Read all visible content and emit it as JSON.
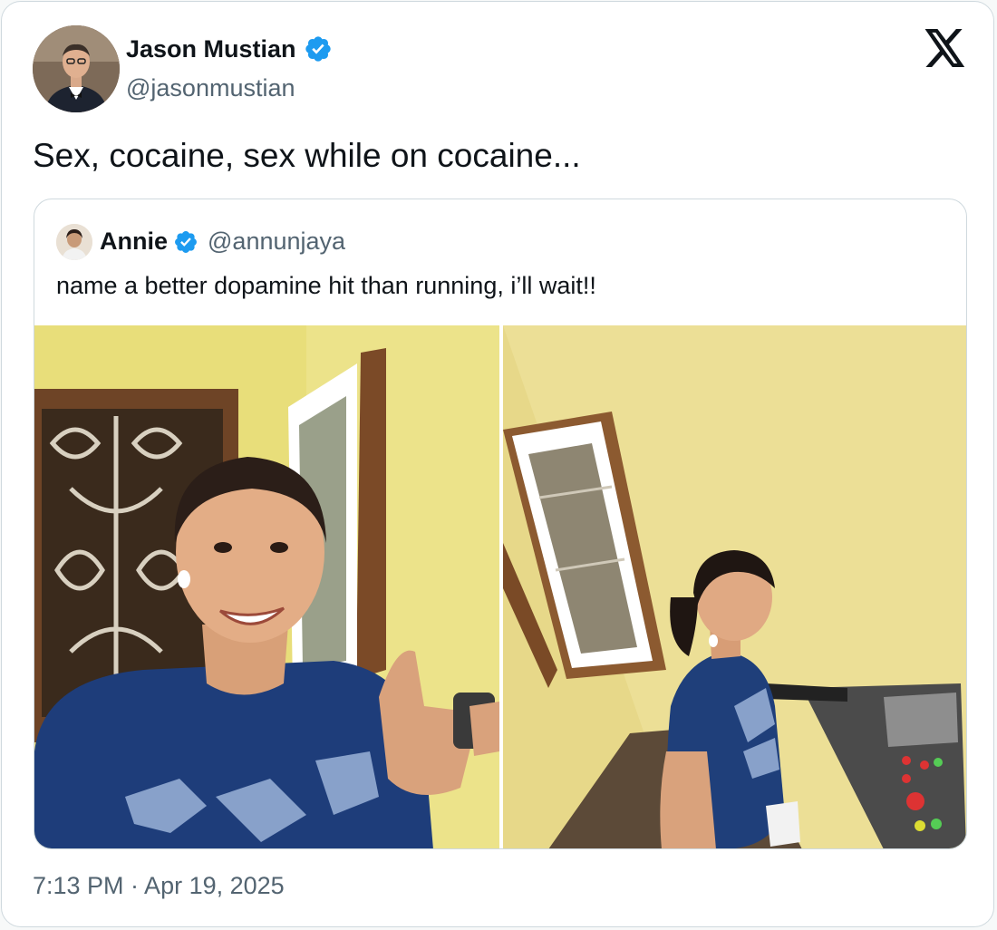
{
  "author": {
    "name": "Jason Mustian",
    "handle": "@jasonmustian",
    "verified": true
  },
  "tweet": {
    "text": "Sex, cocaine, sex while on cocaine...",
    "timestamp": "7:13 PM · Apr 19, 2025"
  },
  "quoted_tweet": {
    "name": "Annie",
    "handle": "@annunjaya",
    "verified": true,
    "text": "name a better dopamine hit than running, i’ll wait!!",
    "photos": [
      "photo-thumbs-up-selfie",
      "photo-treadmill-running"
    ]
  },
  "icons": {
    "verified": "verified-badge-icon",
    "platform": "x-logo-icon"
  },
  "colors": {
    "verified_blue": "#1d9bf0",
    "text_primary": "#0f1419",
    "text_secondary": "#536471",
    "border": "#cfd9de"
  }
}
